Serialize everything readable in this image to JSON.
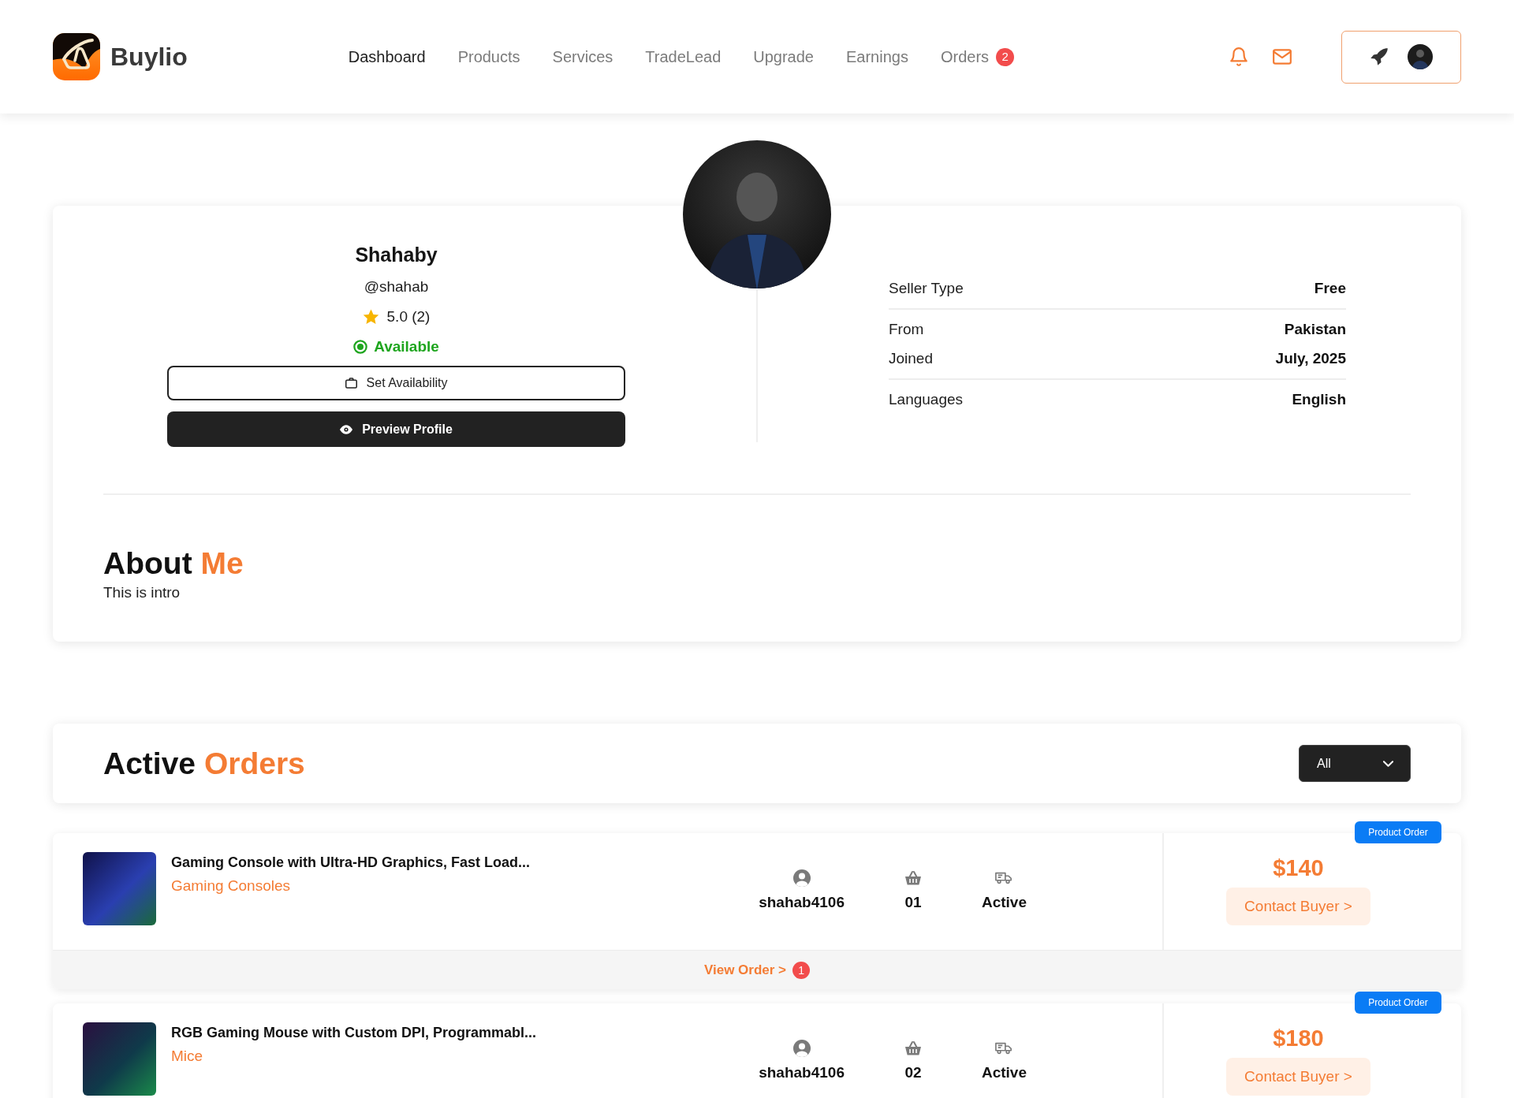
{
  "header": {
    "logo": {
      "name": "Buylio"
    },
    "nav": [
      {
        "label": "Dashboard",
        "selected": true
      },
      {
        "label": "Products",
        "selected": false
      },
      {
        "label": "Services",
        "selected": false
      },
      {
        "label": "TradeLead",
        "selected": false
      },
      {
        "label": "Upgrade",
        "selected": false
      },
      {
        "label": "Earnings",
        "selected": false
      },
      {
        "label": "Orders",
        "selected": false,
        "badge": "2"
      }
    ]
  },
  "profile": {
    "name": "Shahaby",
    "username": "@shahab",
    "rating": "5.0 (2)",
    "status": {
      "label": "Available",
      "available": true
    },
    "buttons": [
      {
        "kind": "outline",
        "label": "Set Availability"
      },
      {
        "kind": "filled",
        "label": "Preview Profile"
      }
    ],
    "detail_groups": [
      {
        "rows": [
          {
            "label": "Seller Type",
            "value": "Free"
          }
        ]
      },
      {
        "rows": [
          {
            "label": "From",
            "value": "Pakistan"
          },
          {
            "label": "Joined",
            "value": "July, 2025"
          }
        ]
      },
      {
        "rows": [
          {
            "label": "Languages",
            "value": "English"
          }
        ]
      }
    ]
  },
  "about": {
    "title": "About",
    "highlight": "Me",
    "text": "This is intro"
  },
  "orders": {
    "title": "Active",
    "highlight": "Orders",
    "filter": {
      "value": "All"
    },
    "items": [
      {
        "badge": "Product Order",
        "title": "Gaming Console with Ultra-HD Graphics, Fast Load...",
        "category": "Gaming Consoles",
        "stats": [
          {
            "kind": "buyer",
            "value": "shahab4106"
          },
          {
            "kind": "quantity",
            "value": "01"
          },
          {
            "kind": "status",
            "value": "Active"
          }
        ],
        "price": "$140",
        "action": "Contact Buyer >",
        "footer": {
          "link": "View Order >",
          "count": "1"
        }
      },
      {
        "badge": "Product Order",
        "title": "RGB Gaming Mouse with Custom DPI, Programmabl...",
        "category": "Mice",
        "stats": [
          {
            "kind": "buyer",
            "value": "shahab4106"
          },
          {
            "kind": "quantity",
            "value": "02"
          },
          {
            "kind": "status",
            "value": "Active"
          }
        ],
        "price": "$180",
        "action": "Contact Buyer >"
      }
    ]
  }
}
